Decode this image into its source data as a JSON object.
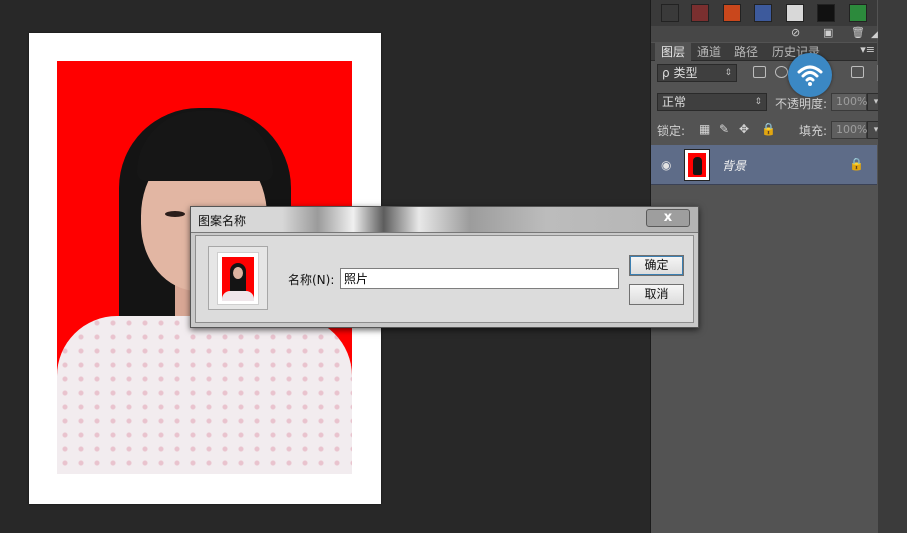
{
  "canvas": {
    "background_color": "#282828",
    "document_background": "#ffffff",
    "photo_background": "#ff0000"
  },
  "panel": {
    "swatches": [
      "#3a3a3a",
      "#7a2f2f",
      "#c9471c",
      "#3d5a9c",
      "#d8d8d8",
      "#111111",
      "#2c8a3c"
    ],
    "icons_row": [
      "no-icon",
      "new-icon",
      "trash-icon",
      "resize-icon"
    ],
    "tabs": [
      {
        "label": "图层",
        "active": true
      },
      {
        "label": "通道",
        "active": false
      },
      {
        "label": "路径",
        "active": false
      },
      {
        "label": "历史记录",
        "active": false
      }
    ],
    "filter": {
      "search_glyph": "ρ",
      "kind_label": "类型"
    },
    "blend": {
      "mode": "正常",
      "opacity_label": "不透明度:",
      "opacity_value": "100%"
    },
    "lock": {
      "label": "锁定:",
      "fill_label": "填充:",
      "fill_value": "100%"
    },
    "layers": [
      {
        "name": "背景",
        "visible": true,
        "locked": true
      }
    ]
  },
  "dialog": {
    "title": "图案名称",
    "close_label": "x",
    "name_label": "名称(N):",
    "name_value": "照片",
    "ok_label": "确定",
    "cancel_label": "取消"
  }
}
